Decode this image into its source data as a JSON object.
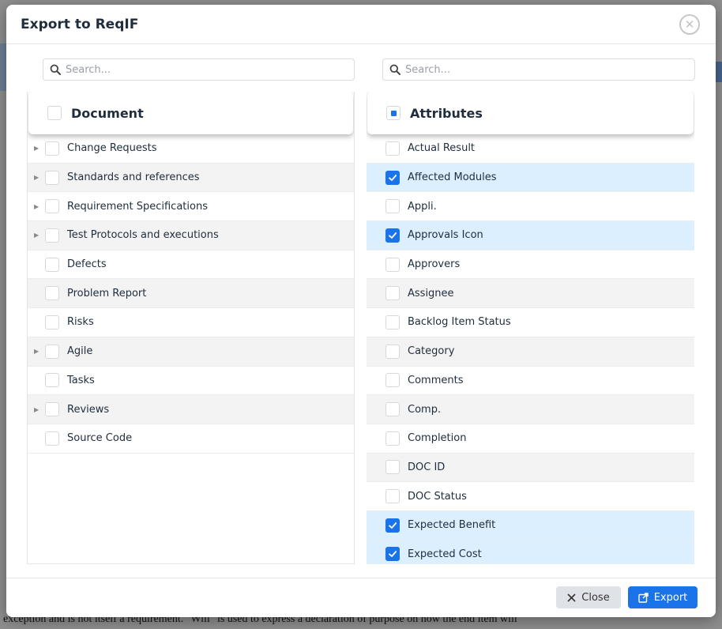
{
  "modal": {
    "title": "Export to ReqIF",
    "close_label": "Close",
    "export_label": "Export"
  },
  "document_panel": {
    "search_placeholder": "Search...",
    "header": "Document",
    "items": [
      {
        "label": "Change Requests",
        "expandable": true,
        "checked": false
      },
      {
        "label": "Standards and references",
        "expandable": true,
        "checked": false
      },
      {
        "label": "Requirement Specifications",
        "expandable": true,
        "checked": false
      },
      {
        "label": "Test Protocols and executions",
        "expandable": true,
        "checked": false
      },
      {
        "label": "Defects",
        "expandable": false,
        "checked": false
      },
      {
        "label": "Problem Report",
        "expandable": false,
        "checked": false
      },
      {
        "label": "Risks",
        "expandable": false,
        "checked": false
      },
      {
        "label": "Agile",
        "expandable": true,
        "checked": false
      },
      {
        "label": "Tasks",
        "expandable": false,
        "checked": false
      },
      {
        "label": "Reviews",
        "expandable": true,
        "checked": false
      },
      {
        "label": "Source Code",
        "expandable": false,
        "checked": false
      }
    ]
  },
  "attributes_panel": {
    "search_placeholder": "Search...",
    "header": "Attributes",
    "items": [
      {
        "label": "Actual Result",
        "checked": false
      },
      {
        "label": "Affected Modules",
        "checked": true
      },
      {
        "label": "Appli.",
        "checked": false
      },
      {
        "label": "Approvals Icon",
        "checked": true
      },
      {
        "label": "Approvers",
        "checked": false
      },
      {
        "label": "Assignee",
        "checked": false
      },
      {
        "label": "Backlog Item Status",
        "checked": false
      },
      {
        "label": "Category",
        "checked": false
      },
      {
        "label": "Comments",
        "checked": false
      },
      {
        "label": "Comp.",
        "checked": false
      },
      {
        "label": "Completion",
        "checked": false
      },
      {
        "label": "DOC ID",
        "checked": false
      },
      {
        "label": "DOC Status",
        "checked": false
      },
      {
        "label": "Expected Benefit",
        "checked": true
      },
      {
        "label": "Expected Cost",
        "checked": true
      }
    ]
  },
  "background": {
    "footer_text": "exception and is not itself a requirement.  \"Will\" is used to express a declaration of purpose on how the end item will"
  },
  "colors": {
    "accent": "#1a73e8",
    "selected_row": "#dcefff",
    "alt_row": "#f3f3f3"
  }
}
